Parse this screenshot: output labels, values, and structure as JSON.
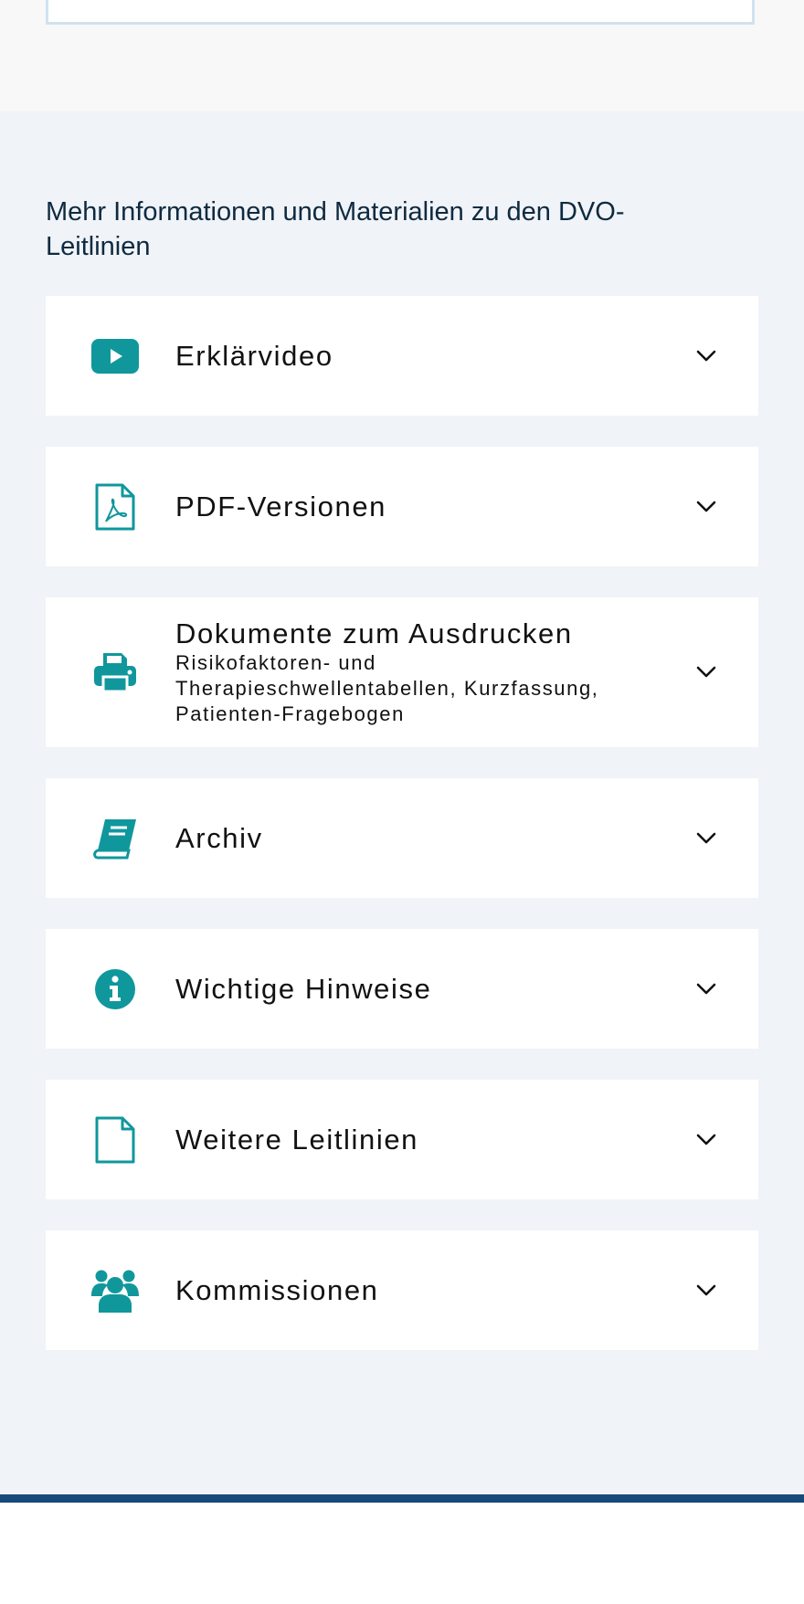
{
  "section": {
    "heading": "Mehr Informationen und Materialien zu den DVO-Leitlinien",
    "accent_color": "#10979c",
    "items": [
      {
        "title": "Erklärvideo",
        "subtitle": "",
        "icon": "youtube-play-icon"
      },
      {
        "title": "PDF-Versionen",
        "subtitle": "",
        "icon": "pdf-file-icon"
      },
      {
        "title": "Dokumente zum Ausdrucken",
        "subtitle": "Risikofaktoren- und Therapieschwellentabellen, Kurzfassung, Patienten-Fragebogen",
        "icon": "printer-icon"
      },
      {
        "title": "Archiv",
        "subtitle": "",
        "icon": "book-icon"
      },
      {
        "title": "Wichtige Hinweise",
        "subtitle": "",
        "icon": "info-circle-icon"
      },
      {
        "title": "Weitere Leitlinien",
        "subtitle": "",
        "icon": "file-icon"
      },
      {
        "title": "Kommissionen",
        "subtitle": "",
        "icon": "users-icon"
      }
    ]
  },
  "footer": {
    "bar_color": "#174a78"
  }
}
